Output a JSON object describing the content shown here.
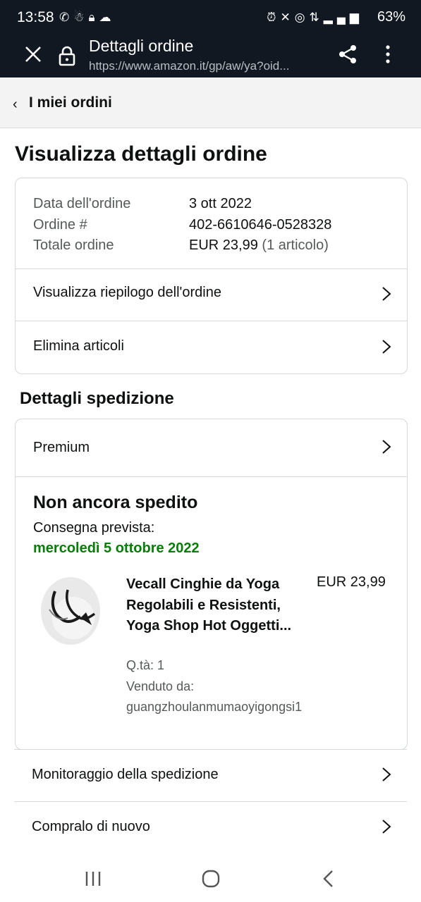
{
  "status_bar": {
    "time": "13:58",
    "left_icons": [
      "whatsapp-icon",
      "notification-icon",
      "lock-icon",
      "cloud-upload-icon"
    ],
    "right_icons": [
      "alarm-icon",
      "mute-icon",
      "hotspot-icon",
      "5g-icon",
      "signal-icon"
    ],
    "battery": "63%"
  },
  "browser": {
    "title": "Dettagli ordine",
    "url": "https://www.amazon.it/gp/aw/ya?oid..."
  },
  "breadcrumb": {
    "label": "I miei ordini"
  },
  "page_title": "Visualizza dettagli ordine",
  "order_summary": {
    "rows": [
      {
        "label": "Data dell'ordine",
        "value": "3 ott 2022",
        "extra": ""
      },
      {
        "label": "Ordine #",
        "value": "402-6610646-0528328",
        "extra": ""
      },
      {
        "label": "Totale ordine",
        "value": "EUR 23,99",
        "extra": "(1 articolo)"
      }
    ],
    "links": [
      {
        "label": "Visualizza riepilogo dell'ordine"
      },
      {
        "label": "Elimina articoli"
      }
    ]
  },
  "shipping": {
    "heading": "Dettagli spedizione",
    "method": "Premium",
    "status": "Non ancora spedito",
    "eta_label": "Consegna prevista:",
    "eta_date": "mercoledì 5 ottobre 2022",
    "item": {
      "name": "Vecall Cinghie da Yoga Regolabili e Resistenti, Yoga Shop Hot Oggetti...",
      "price": "EUR 23,99",
      "qty": "Q.tà: 1",
      "sold_by_label": "Venduto da:",
      "seller": "guangzhoulanmumaoyigongsi1"
    }
  },
  "bottom_links": [
    {
      "label": "Monitoraggio della spedizione"
    },
    {
      "label": "Compralo di nuovo"
    }
  ]
}
